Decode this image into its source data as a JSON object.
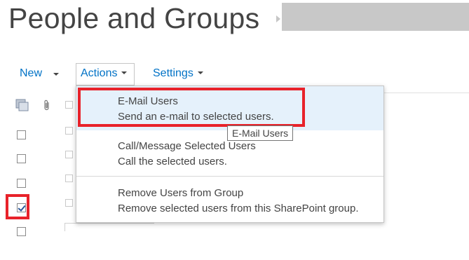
{
  "page": {
    "title": "People and Groups"
  },
  "toolbar": {
    "new_label": "New",
    "actions_label": "Actions",
    "settings_label": "Settings"
  },
  "icons": {
    "users_icon": "users-icon",
    "attachment_icon": "paperclip-icon",
    "breadcrumb_separator": "chevron-right-icon"
  },
  "actions_menu": {
    "items": [
      {
        "title": "E-Mail Users",
        "description": "Send an e-mail to selected users.",
        "highlighted": true
      },
      {
        "title": "Call/Message Selected Users",
        "description": "Call the selected users.",
        "highlighted": false
      },
      {
        "title": "Remove Users from Group",
        "description": "Remove selected users from this SharePoint group.",
        "highlighted": false
      }
    ]
  },
  "tooltip": {
    "text": "E-Mail Users"
  },
  "rows": {
    "checkboxes": [
      false,
      false,
      false,
      true,
      false
    ]
  },
  "colors": {
    "accent_blue": "#0072c6",
    "annotation_red": "#e8222a",
    "menu_hover": "#e5f1fb",
    "text": "#444444",
    "redacted_gray": "#c8c8c8"
  }
}
